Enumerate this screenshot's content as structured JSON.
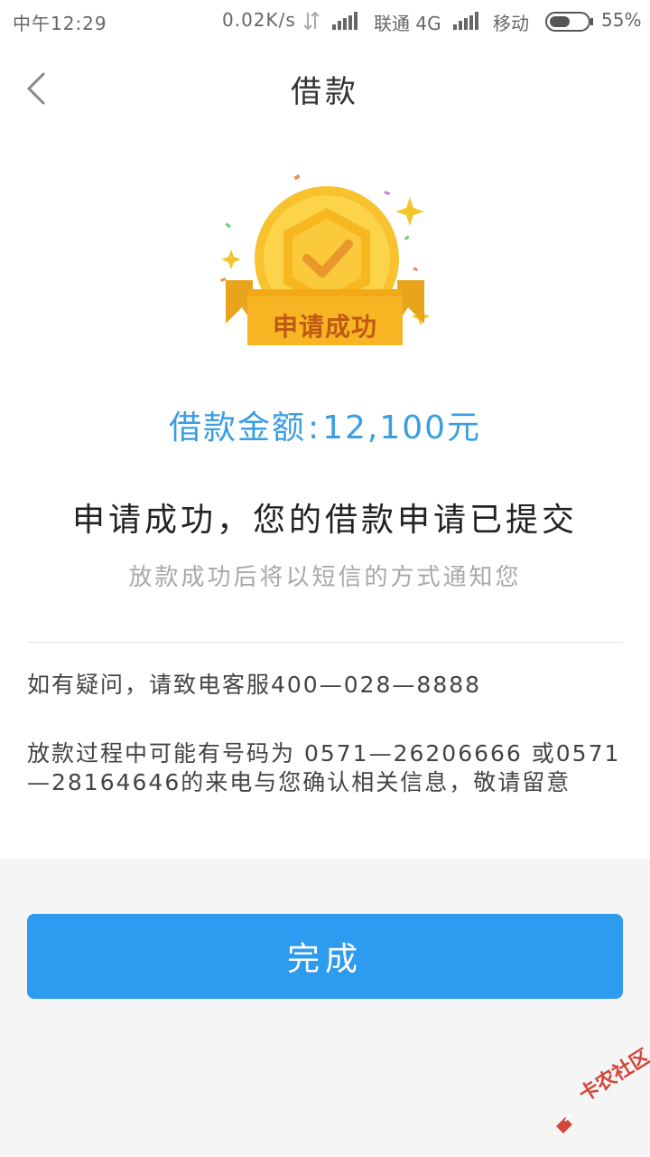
{
  "status_bar": {
    "time": "中午12:29",
    "network_speed": "0.02K/s",
    "carrier1": "联通 4G",
    "carrier2": "移动",
    "battery_percent": "55%",
    "battery_level": 0.55
  },
  "nav": {
    "back_icon": "chevron-left-icon",
    "title": "借款"
  },
  "medal": {
    "label": "申请成功",
    "icon": "checkmark-medal-icon",
    "colors": {
      "gold": "#f8c22e",
      "ribbon": "#f2b01e",
      "check": "#e9962a",
      "label_text": "#c05a12"
    }
  },
  "amount": {
    "label": "借款金额",
    "separator": ":",
    "value": "12,100元"
  },
  "result": {
    "headline": "申请成功，您的借款申请已提交",
    "subline": "放款成功后将以短信的方式通知您"
  },
  "info": {
    "contact": "如有疑问，请致电客服400—028—8888",
    "notice": "放款过程中可能有号码为 0571—26206666 或0571—28164646的来电与您确认相关信息，敬请留意"
  },
  "actions": {
    "done_label": "完成"
  },
  "watermark": {
    "text": "卡农社区"
  },
  "colors": {
    "accent": "#2d9bf0",
    "amount_text": "#3a9ee0",
    "background_bottom": "#f5f5f5"
  }
}
